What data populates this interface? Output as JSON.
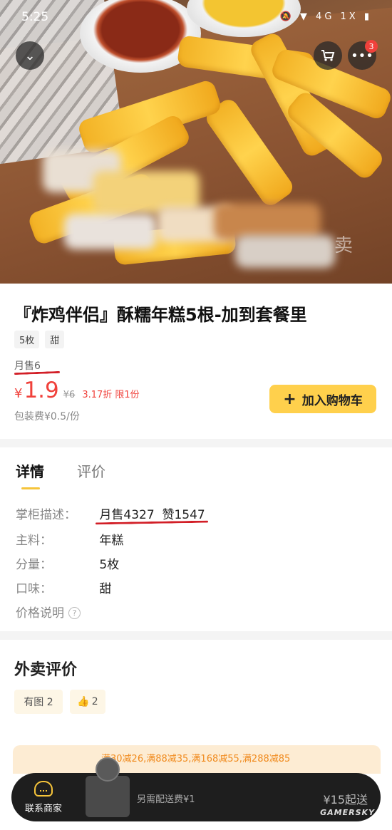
{
  "status_bar": {
    "time": "5:25",
    "icons": "🔕 ▼ 4G 1X ▮"
  },
  "hero": {
    "watermark": "卖",
    "cart_badge": "3"
  },
  "product": {
    "title": "『炸鸡伴侣』酥糯年糕5根-加到套餐里",
    "tags": [
      "5枚",
      "甜"
    ],
    "monthly_sales": "月售6",
    "currency": "¥",
    "price": "1.9",
    "original_price": "¥6",
    "discount": "3.17折 限1份",
    "packing_fee": "包装费¥0.5/份",
    "add_to_cart": "加入购物车"
  },
  "detail": {
    "tabs": [
      "详情",
      "评价"
    ],
    "rows": [
      {
        "label": "掌柜描述：",
        "value": "月售4327  赞1547"
      },
      {
        "label": "主料：",
        "value": "年糕"
      },
      {
        "label": "分量：",
        "value": "5枚"
      },
      {
        "label": "口味：",
        "value": "甜"
      },
      {
        "label": "价格说明",
        "value": ""
      }
    ],
    "help_icon": "?"
  },
  "reviews": {
    "title": "外卖评价",
    "chips": [
      "有图 2",
      "2"
    ],
    "promo": "满30减26,满88减35,满168减55,满288减85",
    "bottom_bar": {
      "contact": "联系商家",
      "extra_delivery": "另需配送费¥1",
      "min_order": "¥15起送"
    },
    "credit": "GAMERSKY"
  },
  "colors": {
    "accent": "#ffd04c",
    "price": "#f0413b",
    "underline": "#d21f27"
  }
}
